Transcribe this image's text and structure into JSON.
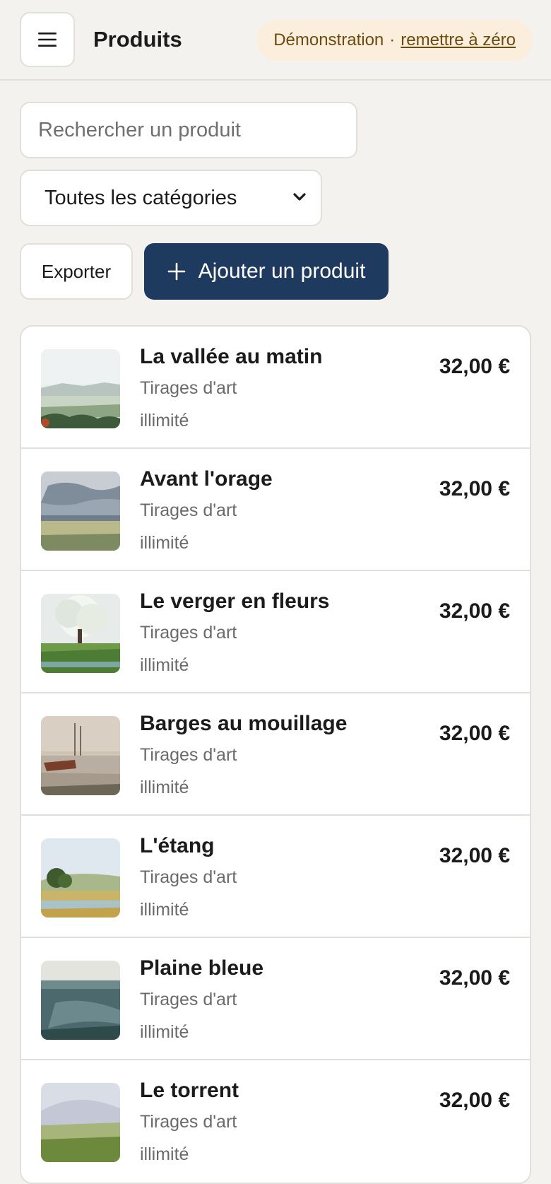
{
  "header": {
    "title": "Produits",
    "demo_label": "Démonstration",
    "demo_separator": "·",
    "reset_link": "remettre à zéro"
  },
  "search": {
    "placeholder": "Rechercher un produit",
    "value": ""
  },
  "category_filter": {
    "selected": "Toutes les catégories"
  },
  "actions": {
    "export_label": "Exporter",
    "add_label": "Ajouter un produit"
  },
  "colors": {
    "accent": "#1f3a5f",
    "demo_bg": "#fbeedd",
    "demo_text": "#6d4a0d"
  },
  "products": [
    {
      "name": "La vallée au matin",
      "category": "Tirages d'art",
      "stock": "illimité",
      "price": "32,00 €"
    },
    {
      "name": "Avant l'orage",
      "category": "Tirages d'art",
      "stock": "illimité",
      "price": "32,00 €"
    },
    {
      "name": "Le verger en fleurs",
      "category": "Tirages d'art",
      "stock": "illimité",
      "price": "32,00 €"
    },
    {
      "name": "Barges au mouillage",
      "category": "Tirages d'art",
      "stock": "illimité",
      "price": "32,00 €"
    },
    {
      "name": "L'étang",
      "category": "Tirages d'art",
      "stock": "illimité",
      "price": "32,00 €"
    },
    {
      "name": "Plaine bleue",
      "category": "Tirages d'art",
      "stock": "illimité",
      "price": "32,00 €"
    },
    {
      "name": "Le torrent",
      "category": "Tirages d'art",
      "stock": "illimité",
      "price": "32,00 €"
    }
  ]
}
